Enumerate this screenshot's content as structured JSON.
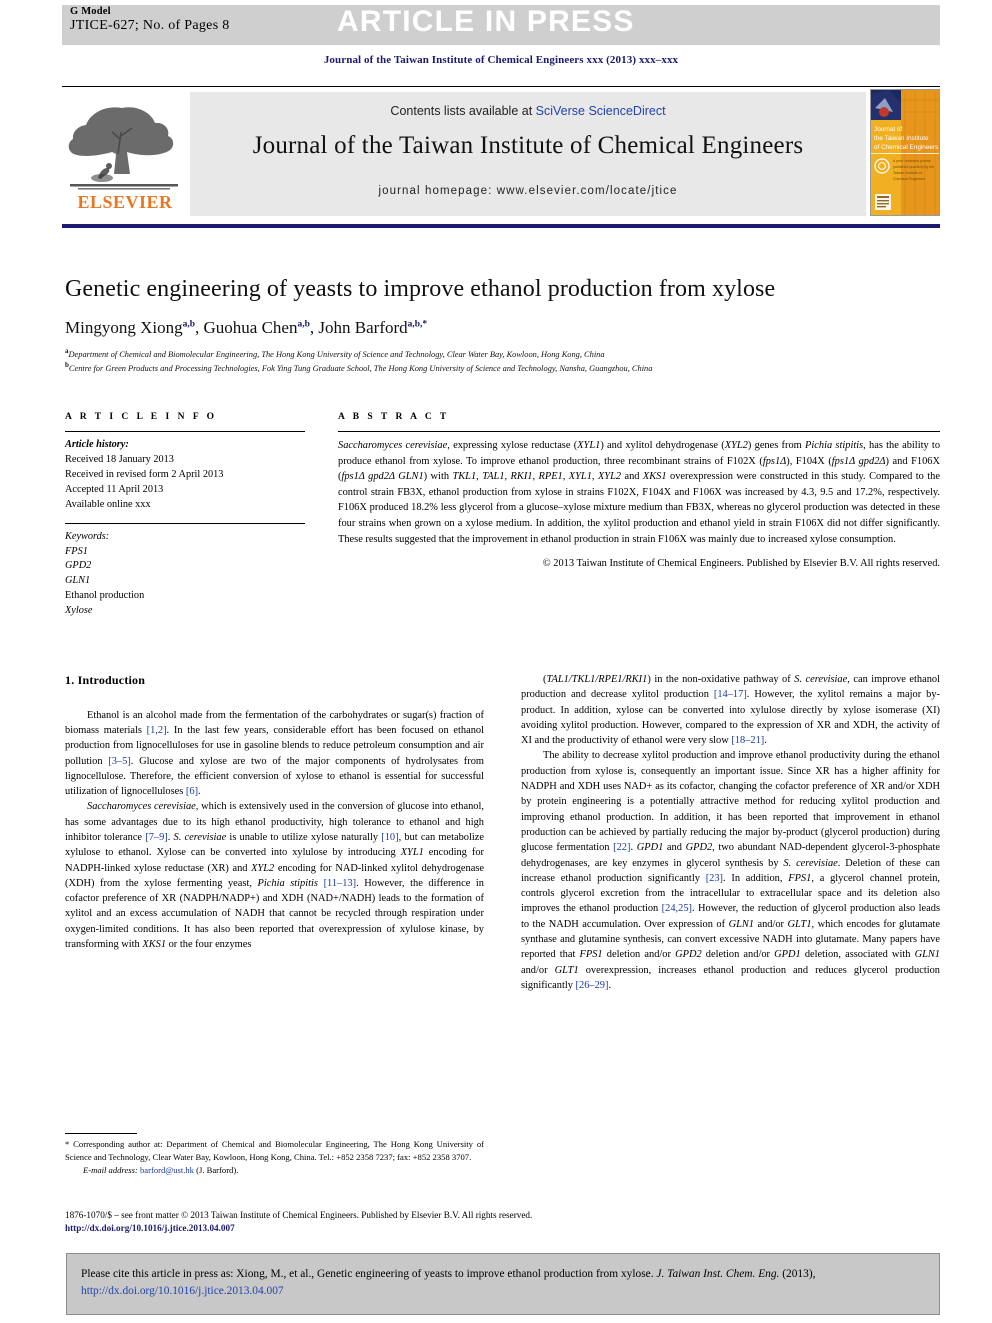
{
  "banner": {
    "g_model_label": "G Model",
    "manuscript_id": "JTICE-627; No. of Pages 8",
    "article_in_press": "ARTICLE IN PRESS"
  },
  "running_head": "Journal of the Taiwan Institute of Chemical Engineers xxx (2013) xxx–xxx",
  "masthead": {
    "contents_prefix": "Contents lists available at ",
    "contents_link": "SciVerse ScienceDirect",
    "journal_title": "Journal of the Taiwan Institute of Chemical Engineers",
    "homepage": "journal homepage: www.elsevier.com/locate/jtice",
    "publisher": "ELSEVIER",
    "cover_title_lines": [
      "Journal of",
      "the Taiwan Institute",
      "of Chemical Engineers"
    ]
  },
  "article": {
    "title": "Genetic engineering of yeasts to improve ethanol production from xylose",
    "authors": [
      {
        "name": "Mingyong Xiong",
        "marks": "a,b"
      },
      {
        "name": "Guohua Chen",
        "marks": "a,b"
      },
      {
        "name": "John Barford",
        "marks": "a,b,*"
      }
    ],
    "affiliations": [
      {
        "mark": "a",
        "text": "Department of Chemical and Biomolecular Engineering, The Hong Kong University of Science and Technology, Clear Water Bay, Kowloon, Hong Kong, China"
      },
      {
        "mark": "b",
        "text": "Centre for Green Products and Processing Technologies, Fok Ying Tung Graduate School, The Hong Kong University of Science and Technology, Nansha, Guangzhou, China"
      }
    ]
  },
  "article_info": {
    "heading": "A R T I C L E   I N F O",
    "history_label": "Article history:",
    "history": [
      "Received 18 January 2013",
      "Received in revised form 2 April 2013",
      "Accepted 11 April 2013",
      "Available online xxx"
    ],
    "keywords_label": "Keywords:",
    "keywords": [
      "FPS1",
      "GPD2",
      "GLN1",
      "Ethanol production",
      "Xylose"
    ]
  },
  "abstract": {
    "heading": "A B S T R A C T",
    "text": "Saccharomyces cerevisiae, expressing xylose reductase (XYL1) and xylitol dehydrogenase (XYL2) genes from Pichia stipitis, has the ability to produce ethanol from xylose. To improve ethanol production, three recombinant strains of F102X (fps1Δ), F104X (fps1Δ gpd2Δ) and F106X (fps1Δ gpd2Δ GLN1) with TKL1, TAL1, RKI1, RPE1, XYL1, XYL2 and XKS1 overexpression were constructed in this study. Compared to the control strain FB3X, ethanol production from xylose in strains F102X, F104X and F106X was increased by 4.3, 9.5 and 17.2%, respectively. F106X produced 18.2% less glycerol from a glucose–xylose mixture medium than FB3X, whereas no glycerol production was detected in these four strains when grown on a xylose medium. In addition, the xylitol production and ethanol yield in strain F106X did not differ significantly. These results suggested that the improvement in ethanol production in strain F106X was mainly due to increased xylose consumption.",
    "copyright": "© 2013 Taiwan Institute of Chemical Engineers. Published by Elsevier B.V. All rights reserved."
  },
  "body": {
    "section_heading": "1. Introduction",
    "left_paragraphs": [
      "Ethanol is an alcohol made from the fermentation of the carbohydrates or sugar(s) fraction of biomass materials [1,2]. In the last few years, considerable effort has been focused on ethanol production from lignocelluloses for use in gasoline blends to reduce petroleum consumption and air pollution [3–5]. Glucose and xylose are two of the major components of hydrolysates from lignocellulose. Therefore, the efficient conversion of xylose to ethanol is essential for successful utilization of lignocelluloses [6].",
      "Saccharomyces cerevisiae, which is extensively used in the conversion of glucose into ethanol, has some advantages due to its high ethanol productivity, high tolerance to ethanol and high inhibitor tolerance [7–9]. S. cerevisiae is unable to utilize xylose naturally [10], but can metabolize xylulose to ethanol. Xylose can be converted into xylulose by introducing XYL1 encoding for NADPH-linked xylose reductase (XR) and XYL2 encoding for NAD-linked xylitol dehydrogenase (XDH) from the xylose fermenting yeast, Pichia stipitis [11–13]. However, the difference in cofactor preference of XR (NADPH/NADP+) and XDH (NAD+/NADH) leads to the formation of xylitol and an excess accumulation of NADH that cannot be recycled through respiration under oxygen-limited conditions. It has also been reported that overexpression of xylulose kinase, by transforming with XKS1 or the four enzymes"
    ],
    "right_paragraphs": [
      "(TAL1/TKL1/RPE1/RKI1) in the non-oxidative pathway of S. cerevisiae, can improve ethanol production and decrease xylitol production [14–17]. However, the xylitol remains a major by-product. In addition, xylose can be converted into xylulose directly by xylose isomerase (XI) avoiding xylitol production. However, compared to the expression of XR and XDH, the activity of XI and the productivity of ethanol were very slow [18–21].",
      "The ability to decrease xylitol production and improve ethanol productivity during the ethanol production from xylose is, consequently an important issue. Since XR has a higher affinity for NADPH and XDH uses NAD+ as its cofactor, changing the cofactor preference of XR and/or XDH by protein engineering is a potentially attractive method for reducing xylitol production and improving ethanol production. In addition, it has been reported that improvement in ethanol production can be achieved by partially reducing the major by-product (glycerol production) during glucose fermentation [22]. GPD1 and GPD2, two abundant NAD-dependent glycerol-3-phosphate dehydrogenases, are key enzymes in glycerol synthesis by S. cerevisiae. Deletion of these can increase ethanol production significantly [23]. In addition, FPS1, a glycerol channel protein, controls glycerol excretion from the intracellular to extracellular space and its deletion also improves the ethanol production [24,25]. However, the reduction of glycerol production also leads to the NADH accumulation. Over expression of GLN1 and/or GLT1, which encodes for glutamate synthase and glutamine synthesis, can convert excessive NADH into glutamate. Many papers have reported that FPS1 deletion and/or GPD2 deletion and/or GPD1 deletion, associated with GLN1 and/or GLT1 overexpression, increases ethanol production and reduces glycerol production significantly [26–29]."
    ]
  },
  "footnote": {
    "corresponding": "* Corresponding author at: Department of Chemical and Biomolecular Engineering, The Hong Kong University of Science and Technology, Clear Water Bay, Kowloon, Hong Kong, China. Tel.: +852 2358 7237; fax: +852 2358 3707.",
    "email_label": "E-mail address:",
    "email": "barford@ust.hk",
    "email_owner": "(J. Barford)."
  },
  "front_matter": {
    "line1": "1876-1070/$ – see front matter © 2013 Taiwan Institute of Chemical Engineers. Published by Elsevier B.V. All rights reserved.",
    "doi": "http://dx.doi.org/10.1016/j.jtice.2013.04.007"
  },
  "cite_box": {
    "text_before": "Please cite this article in press as: Xiong, M., et al., Genetic engineering of yeasts to improve ethanol production from xylose. ",
    "journal_abbrev": "J. Taiwan Inst. Chem. Eng.",
    "year": " (2013), ",
    "doi": "http://dx.doi.org/10.1016/j.jtice.2013.04.007"
  },
  "colors": {
    "banner_gray": "#cfcfcf",
    "link_blue": "#2244aa",
    "ref_blue": "#1a3a9e",
    "navy": "#1a1a6e",
    "elsevier_orange": "#E87722",
    "mast_gray": "#e8e8e8",
    "cite_gray": "#c8c8c8"
  }
}
